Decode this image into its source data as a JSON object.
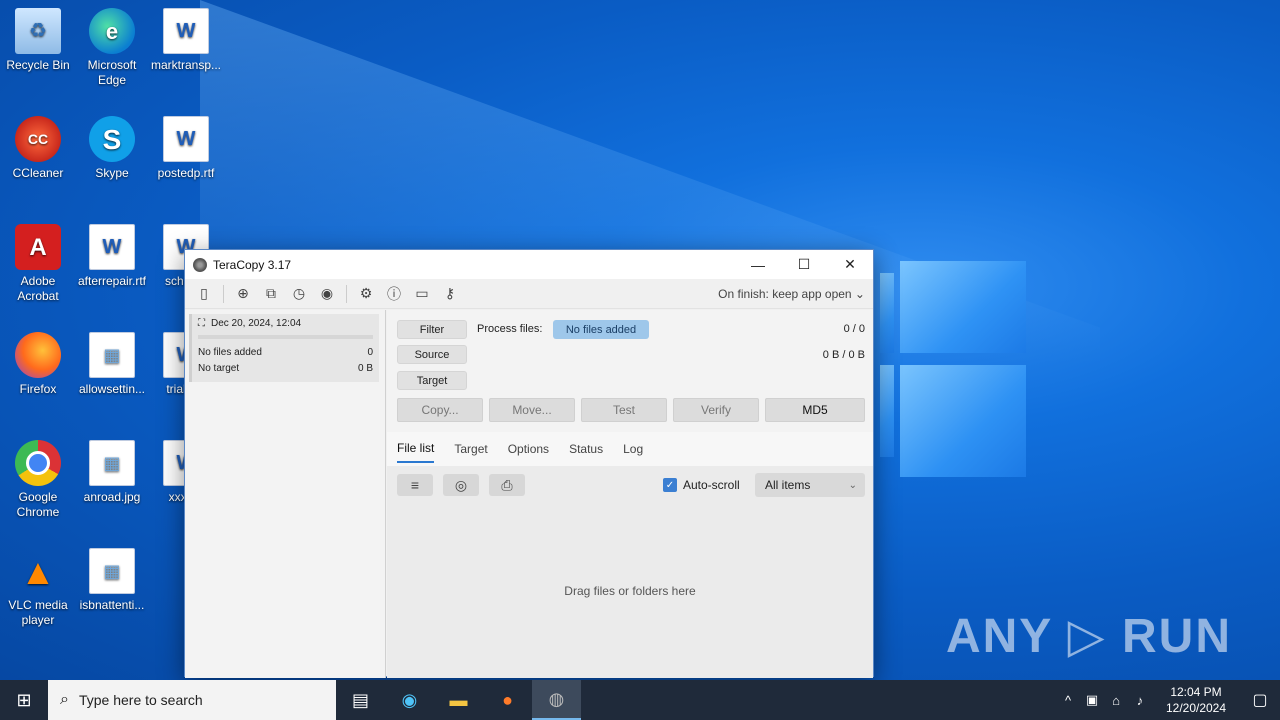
{
  "desktop": {
    "icons": [
      {
        "label": "Recycle Bin"
      },
      {
        "label": "Microsoft Edge"
      },
      {
        "label": "marktransp..."
      },
      {
        "label": "CCleaner"
      },
      {
        "label": "Skype"
      },
      {
        "label": "postedp.rtf"
      },
      {
        "label": "Adobe Acrobat"
      },
      {
        "label": "afterrepair.rtf"
      },
      {
        "label": "schoo..."
      },
      {
        "label": "Firefox"
      },
      {
        "label": "allowsettin..."
      },
      {
        "label": "trialm..."
      },
      {
        "label": "Google Chrome"
      },
      {
        "label": "anroad.jpg"
      },
      {
        "label": "xxxg..."
      },
      {
        "label": "VLC media player"
      },
      {
        "label": "isbnattenti..."
      }
    ],
    "watermark": "ANY ▷ RUN"
  },
  "window": {
    "title": "TeraCopy 3.17",
    "on_finish": "On finish: keep app open ⌄",
    "job": {
      "date": "Dec 20, 2024, 12:04",
      "files_label": "No files added",
      "files_count": "0",
      "target_label": "No target",
      "target_size": "0 B"
    },
    "buttons": {
      "filter": "Filter",
      "source": "Source",
      "target": "Target",
      "copy": "Copy...",
      "move": "Move...",
      "test": "Test",
      "verify": "Verify",
      "md5": "MD5"
    },
    "process_files_label": "Process files:",
    "process_badge": "No files added",
    "file_count": "0 / 0",
    "size_count": "0 B / 0 B",
    "tabs": [
      "File list",
      "Target",
      "Options",
      "Status",
      "Log"
    ],
    "autoscroll_label": "Auto-scroll",
    "filter_select": "All items",
    "drop_hint": "Drag files or folders here"
  },
  "taskbar": {
    "search_placeholder": "Type here to search",
    "time": "12:04 PM",
    "date": "12/20/2024"
  }
}
